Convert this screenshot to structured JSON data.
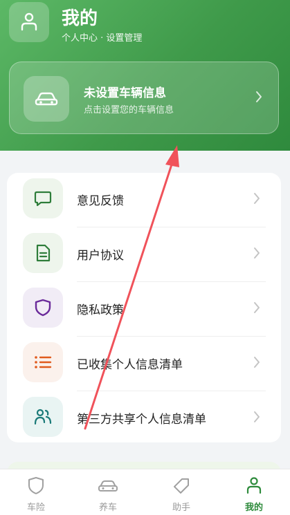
{
  "header": {
    "title": "我的",
    "subtitle": "个人中心 · 设置管理"
  },
  "vehicle": {
    "title": "未设置车辆信息",
    "subtitle": "点击设置您的车辆信息"
  },
  "menu": {
    "items": [
      {
        "label": "意见反馈",
        "icon": "message-icon"
      },
      {
        "label": "用户协议",
        "icon": "document-icon"
      },
      {
        "label": "隐私政策",
        "icon": "shield-icon"
      },
      {
        "label": "已收集个人信息清单",
        "icon": "list-icon"
      },
      {
        "label": "第三方共享个人信息清单",
        "icon": "people-icon"
      }
    ]
  },
  "tabbar": {
    "tabs": [
      {
        "label": "车险",
        "icon": "shield-icon",
        "active": false
      },
      {
        "label": "养车",
        "icon": "car-icon",
        "active": false
      },
      {
        "label": "助手",
        "icon": "tag-icon",
        "active": false
      },
      {
        "label": "我的",
        "icon": "person-icon",
        "active": true
      }
    ]
  },
  "colors": {
    "brand_green": "#3f9a4a",
    "active_tab": "#2e8b3c",
    "annotation_arrow": "#f0525a"
  }
}
